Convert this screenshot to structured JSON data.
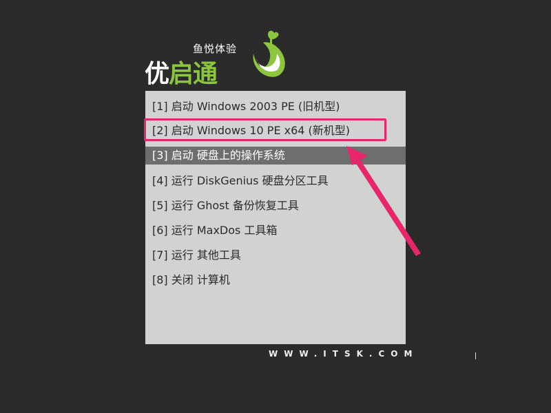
{
  "logo": {
    "tagline": "鱼悦体验",
    "name_part1": "优",
    "name_part2": "启",
    "name_part3": "通",
    "colors": {
      "white": "#ffffff",
      "green": "#8cc63f"
    }
  },
  "menu": {
    "items": [
      {
        "label": "[1] 启动 Windows 2003 PE (旧机型)"
      },
      {
        "label": "[2] 启动 Windows 10 PE x64 (新机型)"
      },
      {
        "label": "[3] 启动 硬盘上的操作系统"
      },
      {
        "label": "[4] 运行 DiskGenius 硬盘分区工具"
      },
      {
        "label": "[5] 运行 Ghost 备份恢复工具"
      },
      {
        "label": "[6] 运行 MaxDos 工具箱"
      },
      {
        "label": "[7] 运行 其他工具"
      },
      {
        "label": "[8] 关闭 计算机"
      }
    ],
    "selected_index": 3
  },
  "annotation": {
    "color": "#e8266b"
  },
  "footer": {
    "url": "WWW.ITSK.COM"
  }
}
